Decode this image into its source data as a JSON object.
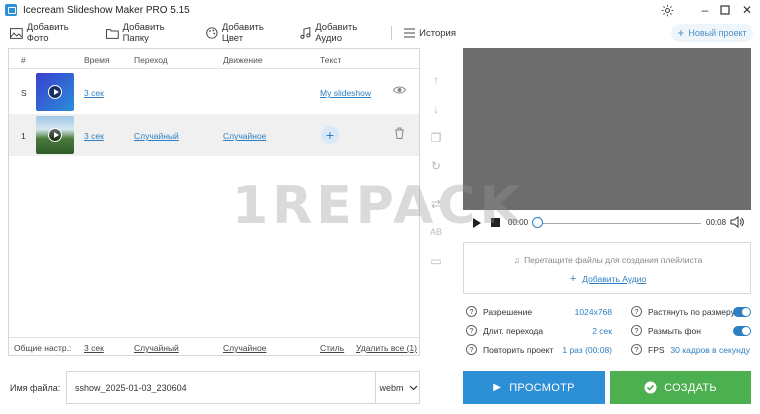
{
  "window": {
    "title": "Icecream Slideshow Maker PRO 5.15"
  },
  "toolbar": {
    "add_photo": "Добавить Фото",
    "add_folder": "Добавить Папку",
    "add_color": "Добавить Цвет",
    "add_audio": "Добавить Аудио",
    "history": "История",
    "new_project": "Новый проект"
  },
  "table": {
    "headers": {
      "num": "#",
      "time": "Время",
      "transition": "Переход",
      "motion": "Движение",
      "text": "Текст"
    },
    "rows": [
      {
        "num": "S",
        "time": "3 сек",
        "transition": "",
        "motion": "",
        "text": "My slideshow"
      },
      {
        "num": "1",
        "time": "3 сек",
        "transition": "Случайный",
        "motion": "Случайное",
        "text": ""
      }
    ],
    "footer": {
      "label": "Общие настр.:",
      "time": "3 сек",
      "transition": "Случайный",
      "motion": "Случайное",
      "style": "Стиль",
      "delete_all": "Удалить все (1)"
    }
  },
  "player": {
    "current": "00:00",
    "total": "00:08",
    "progress": 0
  },
  "playlist": {
    "hint": "Перетащите файлы для создания плейлиста",
    "add_audio": "Добавить Аудио"
  },
  "settings": {
    "resolution_label": "Разрешение",
    "resolution_value": "1024x768",
    "transition_label": "Длит. перехода",
    "transition_value": "2 сек",
    "repeat_label": "Повторить проект",
    "repeat_value": "1 раз (00:08)",
    "stretch_label": "Растянуть по размеру",
    "stretch_on": true,
    "blur_label": "Размыть фон",
    "blur_on": true,
    "fps_label": "FPS",
    "fps_value": "30 кадров в секунду"
  },
  "file": {
    "label": "Имя файла:",
    "value": "sshow_2025-01-03_230604",
    "format": "webm"
  },
  "actions": {
    "preview": "ПРОСМОТР",
    "create": "СОЗДАТЬ"
  },
  "watermark": "1REPACK",
  "colors": {
    "accent": "#2d8fd5",
    "create": "#4caf50"
  }
}
